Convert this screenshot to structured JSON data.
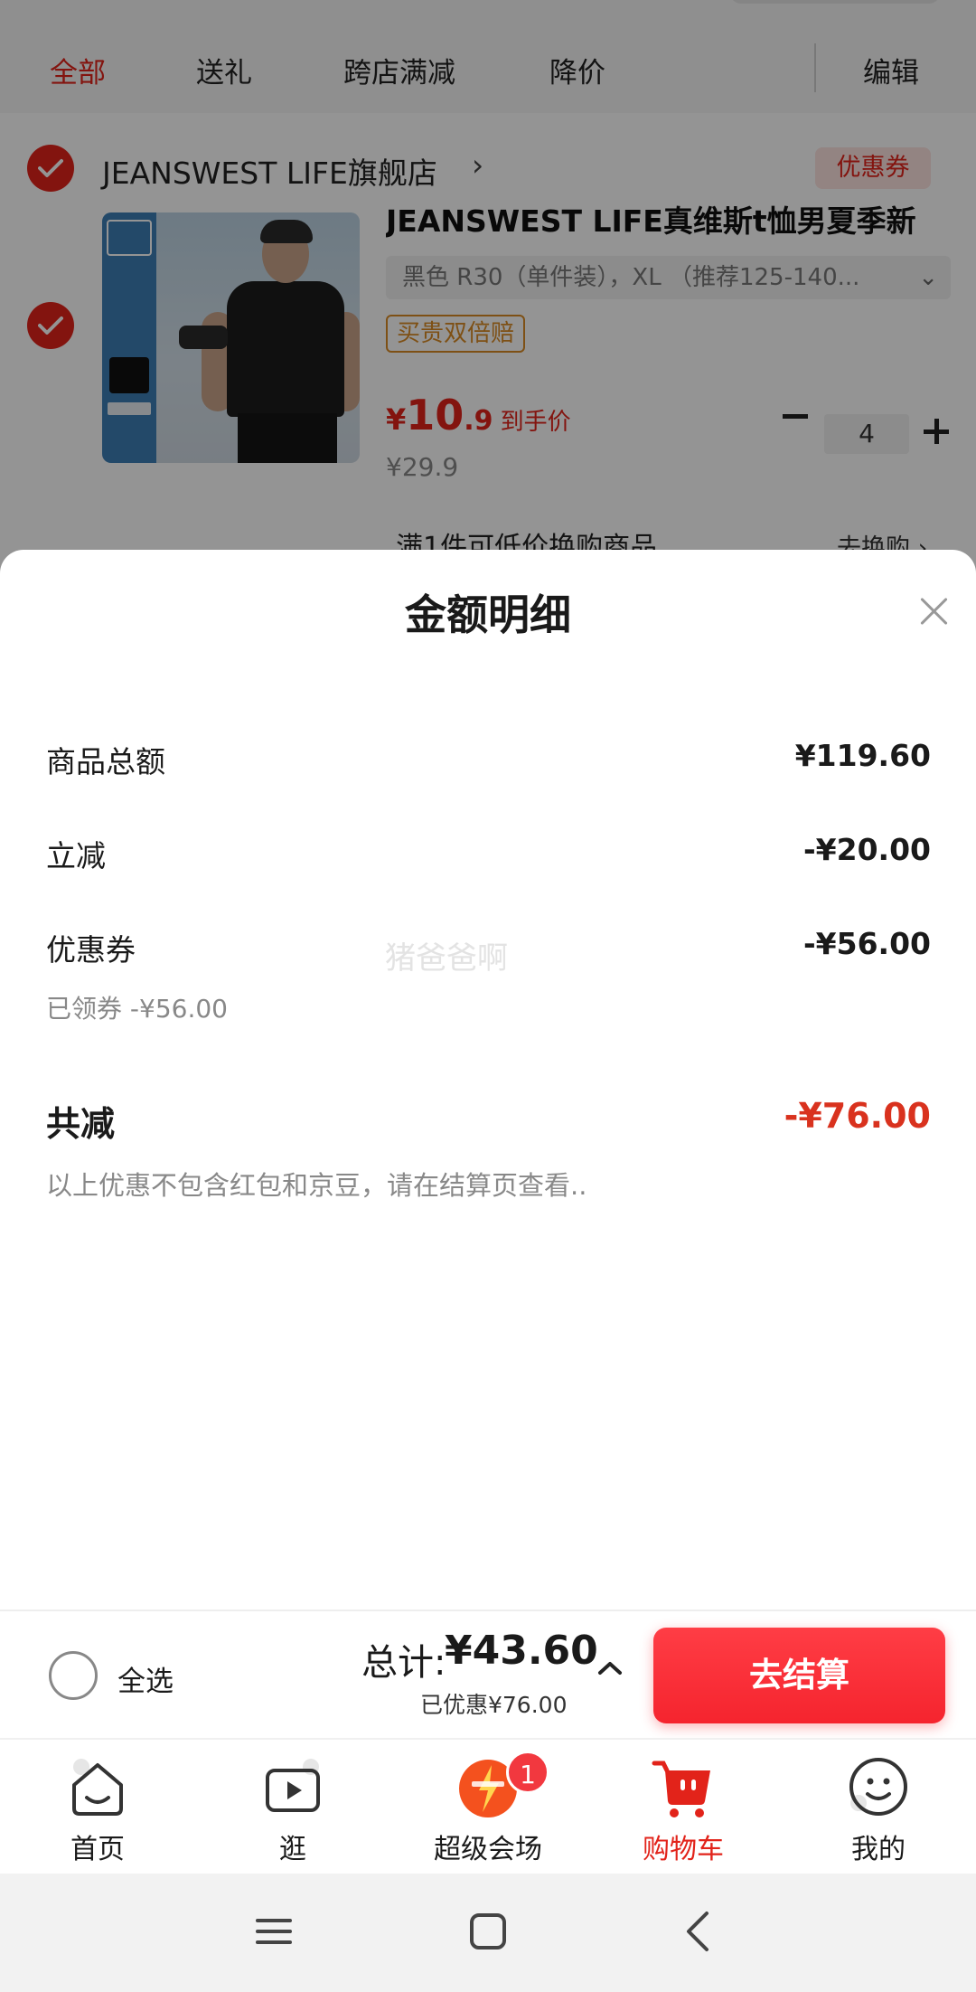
{
  "filter_tabs": [
    {
      "label": "全部",
      "active": true
    },
    {
      "label": "送礼",
      "active": false
    },
    {
      "label": "跨店满减",
      "active": false
    },
    {
      "label": "降价",
      "active": false
    }
  ],
  "edit_label": "编辑",
  "shop": {
    "name": "JEANSWEST LIFE旗舰店",
    "chevron": "›",
    "coupon_label": "优惠券"
  },
  "product": {
    "title": "JEANSWEST LIFE真维斯t恤男夏季新",
    "spec": "黑色 R30（单件装），XL （推荐125-140...",
    "spec_chevron": "⌄",
    "guarantee_tag": "买贵双倍赔",
    "price_currency": "¥",
    "price_integer": "10",
    "price_decimal": ".9",
    "price_note": "到手价",
    "original_price": "¥29.9",
    "quantity": "4",
    "promo_text": "满1件可低价换购商品",
    "promo_link": "去换购 ›"
  },
  "sheet": {
    "title": "金额明细",
    "rows": [
      {
        "label": "商品总额",
        "value": "¥119.60"
      },
      {
        "label": "立减",
        "value": "-¥20.00"
      },
      {
        "label": "优惠券",
        "value": "-¥56.00"
      }
    ],
    "coupon_sub": "已领券 -¥56.00",
    "total_label": "共减",
    "total_value": "-¥76.00",
    "total_note": "以上优惠不包含红包和京豆，请在结算页查看..",
    "watermark": "猪爸爸啊"
  },
  "checkout": {
    "select_all": "全选",
    "sum_label": "总计:",
    "sum_value": "¥43.60",
    "saved": "已优惠¥76.00",
    "button": "去结算"
  },
  "tabs": [
    {
      "label": "首页",
      "icon": "home-icon",
      "active": false
    },
    {
      "label": "逛",
      "icon": "video-icon",
      "active": false
    },
    {
      "label": "超级会场",
      "icon": "super-venue-icon",
      "active": false,
      "badge": "1"
    },
    {
      "label": "购物车",
      "icon": "cart-icon",
      "active": true
    },
    {
      "label": "我的",
      "icon": "profile-icon",
      "active": false
    }
  ],
  "colors": {
    "accent": "#e2231a",
    "checkout_button": "#f5242e",
    "discount_total": "#d9321e"
  }
}
